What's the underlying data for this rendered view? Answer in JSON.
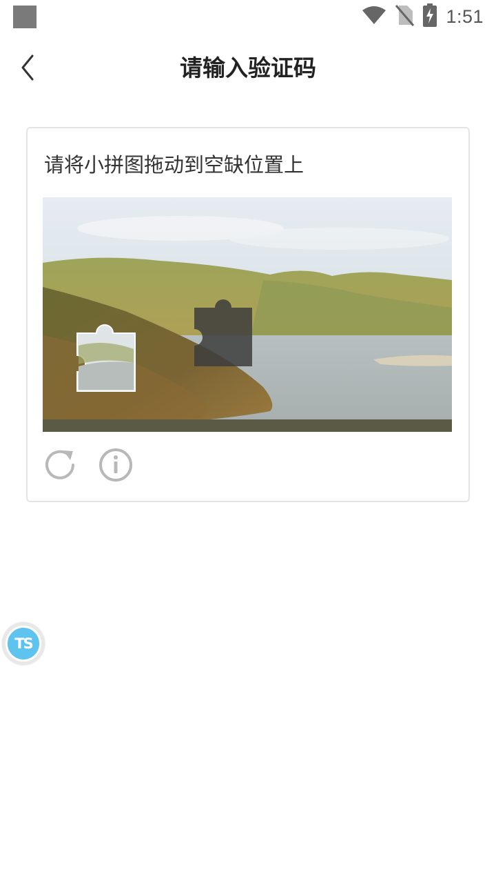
{
  "status_bar": {
    "time": "1:51",
    "icons": [
      "notification-square-icon",
      "wifi-icon",
      "no-sim-icon",
      "battery-charging-icon"
    ]
  },
  "header": {
    "back_icon": "chevron-left-icon",
    "title": "请输入验证码"
  },
  "captcha": {
    "instruction": "请将小拼图拖动到空缺位置上",
    "image_description": "landscape-puzzle",
    "tools": [
      "refresh-icon",
      "info-icon"
    ]
  },
  "floating_badge": {
    "text": "TS"
  }
}
